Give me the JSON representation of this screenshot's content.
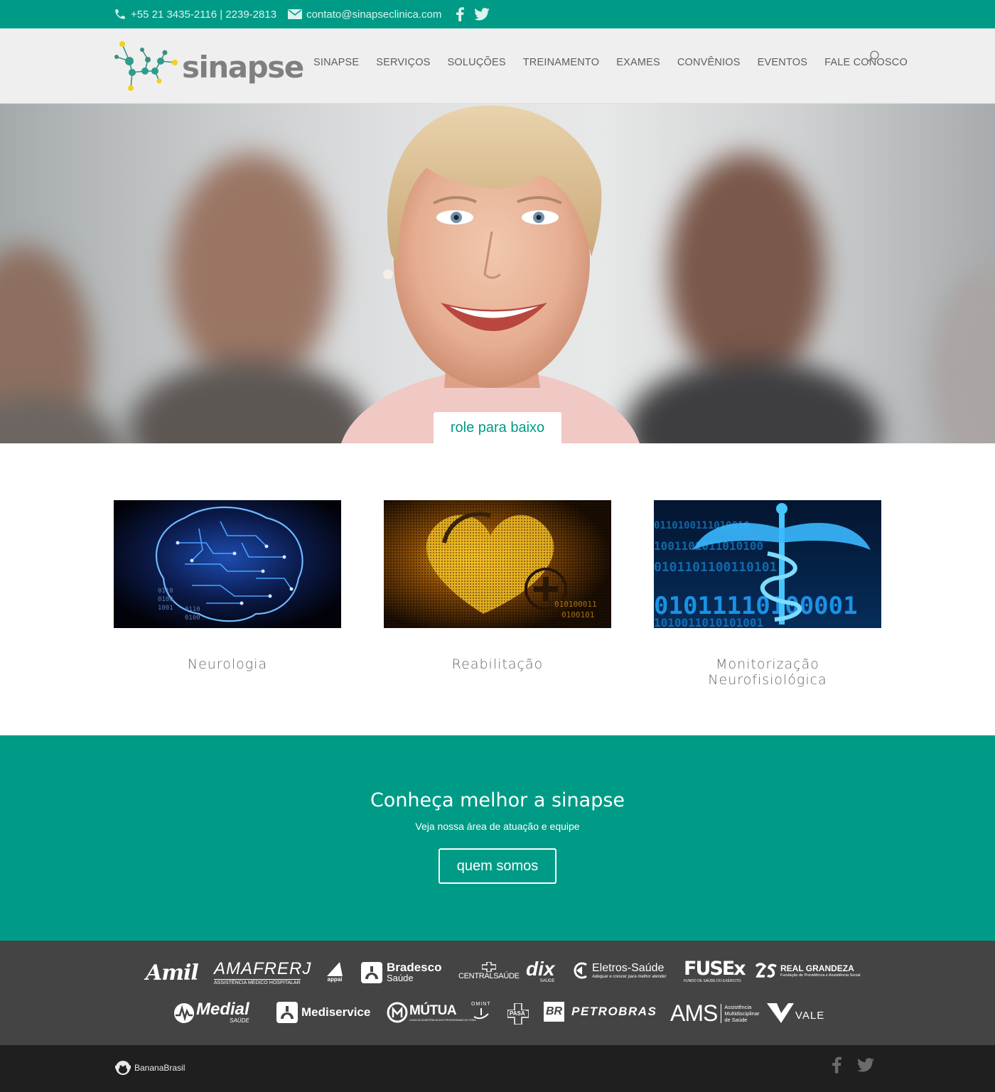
{
  "colors": {
    "brand": "#009b86",
    "header_bg": "#efefef",
    "partners_bg": "#444444",
    "footer_bg": "#1f1f1f"
  },
  "topbar": {
    "phone": "+55 21 3435-2116 | 2239-2813",
    "email": "contato@sinapseclinica.com",
    "social_icons": [
      "facebook-icon",
      "twitter-icon"
    ]
  },
  "header": {
    "logo_text": "sinapse",
    "nav": [
      "SINAPSE",
      "SERVIÇOS",
      "SOLUÇÕES",
      "TREINAMENTO",
      "EXAMES",
      "CONVÊNIOS",
      "EVENTOS",
      "FALE CONOSCO"
    ],
    "search_icon": "search-icon"
  },
  "hero": {
    "scroll_label": "role para baixo"
  },
  "services": [
    {
      "label": "Neurologia"
    },
    {
      "label": "Reabilitação"
    },
    {
      "label": "Monitorização Neurofisiológica"
    }
  ],
  "cta": {
    "title": "Conheça melhor a sinapse",
    "subtitle": "Veja nossa área de atuação e equipe",
    "button": "quem somos"
  },
  "partners": {
    "row1": [
      "Amil",
      "AMAFRERJ",
      "appai",
      "Bradesco",
      "CENTRALSAÚDE",
      "dix",
      "Eletros-Saúde",
      "FUSEx",
      "REAL GRANDEZA"
    ],
    "row1_sub": {
      "amafrerj": "ASSISTÊNCIA MÉDICO HOSPITALAR",
      "bradesco": "Saúde",
      "dix": "SAÚDE",
      "eletros": "Adequar e crescer para melhor atender",
      "fusex": "FUNDO DE SAÚDE DO EXÉRCITO",
      "real_grandeza": "Fundação de Previdência e Assistência Social"
    },
    "row2": [
      "Medial",
      "Mediservice",
      "MÚTUA",
      "OMINT",
      "PASA",
      "BR",
      "PETROBRAS",
      "AMS",
      "VALE"
    ],
    "row2_sub": {
      "medial": "SAÚDE",
      "mutua": "CAIXA DE ASSISTÊNCIA DOS PROFISSIONAIS DO CREA",
      "ams": [
        "Assistência",
        "Multidisciplinar",
        "de Saúde"
      ]
    }
  },
  "footer": {
    "credit": "BananaBrasil",
    "social_icons": [
      "facebook-icon",
      "twitter-icon"
    ]
  }
}
